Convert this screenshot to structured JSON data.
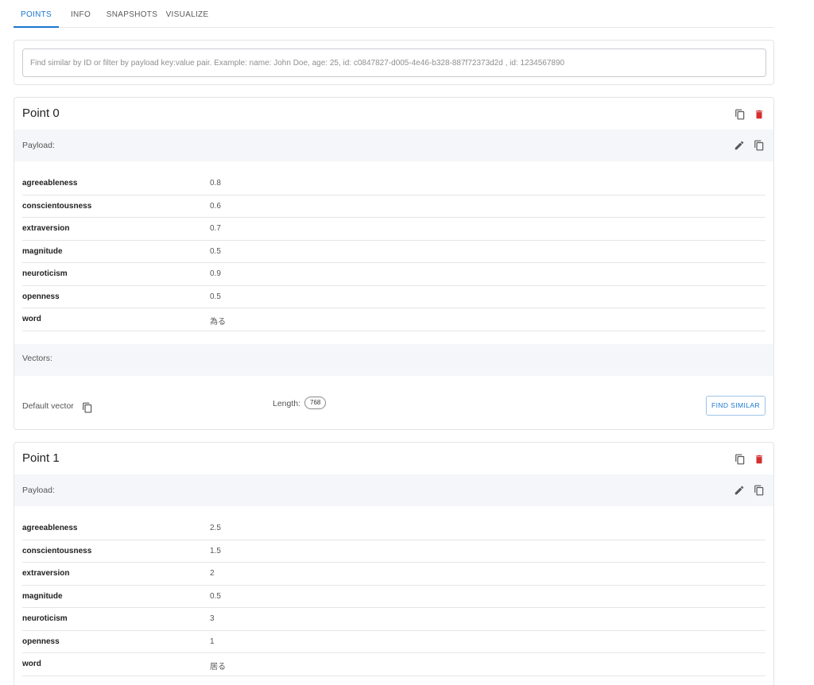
{
  "tabs": [
    {
      "label": "POINTS",
      "active": true
    },
    {
      "label": "INFO",
      "active": false
    },
    {
      "label": "SNAPSHOTS",
      "active": false
    },
    {
      "label": "VISUALIZE",
      "active": false
    }
  ],
  "search": {
    "placeholder": "Find similar by ID or filter by payload key:value pair. Example: name: John Doe, age: 25, id: c0847827-d005-4e46-b328-887f72373d2d , id: 1234567890",
    "value": ""
  },
  "icons": {
    "copy": "copy-icon",
    "delete": "delete-icon",
    "edit": "pencil-icon"
  },
  "colors": {
    "accent": "#1976d2",
    "delete": "#d32f2f",
    "section_bg": "#f4f6f9"
  },
  "points": [
    {
      "title": "Point 0",
      "payload_label": "Payload:",
      "payload": [
        {
          "key": "agreeableness",
          "value": "0.8"
        },
        {
          "key": "conscientousness",
          "value": "0.6"
        },
        {
          "key": "extraversion",
          "value": "0.7"
        },
        {
          "key": "magnitude",
          "value": "0.5"
        },
        {
          "key": "neuroticism",
          "value": "0.9"
        },
        {
          "key": "openness",
          "value": "0.5"
        },
        {
          "key": "word",
          "value": "為る"
        }
      ],
      "vectors_label": "Vectors:",
      "vectors": [
        {
          "name": "Default vector",
          "length_label": "Length:",
          "length": "768",
          "action": "FIND SIMILAR"
        }
      ]
    },
    {
      "title": "Point 1",
      "payload_label": "Payload:",
      "payload": [
        {
          "key": "agreeableness",
          "value": "2.5"
        },
        {
          "key": "conscientousness",
          "value": "1.5"
        },
        {
          "key": "extraversion",
          "value": "2"
        },
        {
          "key": "magnitude",
          "value": "0.5"
        },
        {
          "key": "neuroticism",
          "value": "3"
        },
        {
          "key": "openness",
          "value": "1"
        },
        {
          "key": "word",
          "value": "居る"
        }
      ]
    }
  ]
}
